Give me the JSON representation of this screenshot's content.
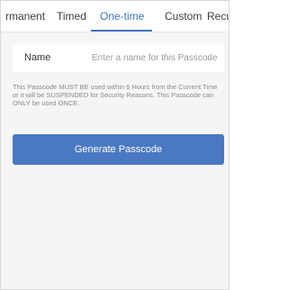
{
  "tabs": {
    "permanent": "rmanent",
    "timed": "Timed",
    "onetime": "One-time",
    "custom": "Custom",
    "recurring": "Recurrin"
  },
  "active_tab": "One-time",
  "form": {
    "name_label": "Name",
    "name_placeholder": "Enter a name for this Passcode",
    "name_value": ""
  },
  "notice": "This Passcode MUST BE used within 6 Hours from the Current Time or it will be SUSPENDED for Security Reasons. This Passcode can ONLY be used ONCE.",
  "actions": {
    "generate_label": "Generate Passcode"
  },
  "colors": {
    "accent": "#3f75c6",
    "button": "#4a78c2",
    "background": "#f5f5f5"
  }
}
